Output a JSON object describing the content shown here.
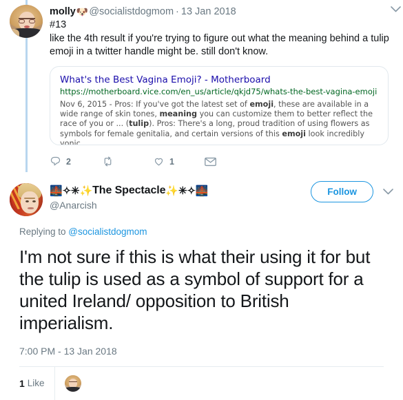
{
  "colors": {
    "twitter_blue": "#1b95e0",
    "thread_line": "#b8d6ef",
    "muted_text": "#697882",
    "link_green": "#006621",
    "link_blue": "#1a0dab",
    "border": "#e6ecf0"
  },
  "parent_tweet": {
    "avatar_name": "molly-avatar",
    "display_name": "molly",
    "display_name_emoji": "🐶",
    "handle": "@socialistdogmom",
    "separator": "·",
    "date": "13 Jan 2018",
    "caret_icon": "chevron-down-icon",
    "body_line_1": "#13",
    "body_line_2": "like the 4th result if you're trying to figure out what the meaning behind a tulip",
    "body_line_3": "emoji in a twitter handle might be. still don't know.",
    "card": {
      "title": "What's the Best Vagina Emoji? - Motherboard",
      "url": "https://motherboard.vice.com/en_us/article/qkjd75/whats-the-best-vagina-emoji",
      "url_dropdown_icon": "▾",
      "snippet_part_1": "Nov 6, 2015 - Pros: If you've got the latest set of ",
      "snippet_bold_1": "emoji",
      "snippet_part_2": ", these are available in a wide range of skin tones, ",
      "snippet_bold_2": "meaning",
      "snippet_part_3": " you can customize them to better reflect the race of you or ... (",
      "snippet_bold_3": "tulip",
      "snippet_part_4": "). Pros: There's a long, proud tradition of using flowers as symbols for female genitalia, and certain versions of this ",
      "snippet_bold_4": "emoji",
      "snippet_part_5": " look incredibly yonic."
    },
    "actions": {
      "reply_icon": "reply-icon",
      "reply_count": "2",
      "retweet_icon": "retweet-icon",
      "retweet_count": "",
      "like_icon": "heart-icon",
      "like_count": "1",
      "dm_icon": "envelope-icon"
    }
  },
  "focus_tweet": {
    "avatar_name": "anarcish-avatar",
    "display_name_emoji_prefix": "🌉✧✳✨",
    "display_name": "The Spectacle",
    "display_name_emoji_suffix": "✨✳✧🌉",
    "handle": "@Anarcish",
    "follow_label": "Follow",
    "caret_icon": "chevron-down-icon",
    "replying_prefix": "Replying to ",
    "replying_handle": "@socialistdogmom",
    "body_line_1": "I'm not sure if this is what their using it for",
    "body_line_2": "but the tulip is used as a symbol of support",
    "body_line_3": "for a united Ireland/ opposition to British",
    "body_line_4": "imperialism.",
    "timestamp": "7:00 PM - 13 Jan 2018",
    "stats": {
      "like_count": "1",
      "like_label": "Like",
      "liker_avatar_name": "molly-mini-avatar"
    }
  }
}
